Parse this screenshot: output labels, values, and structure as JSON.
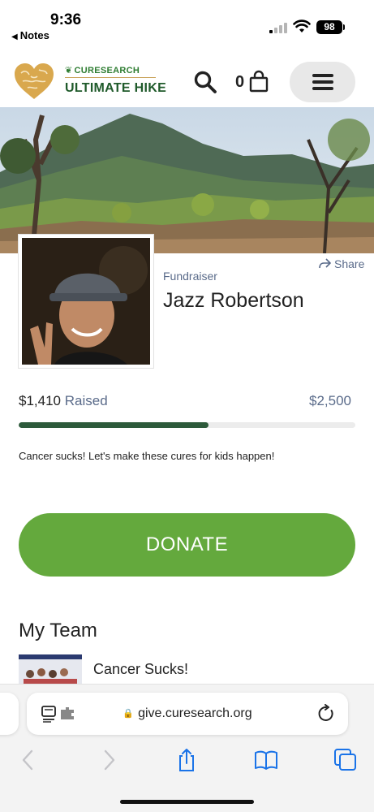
{
  "status": {
    "time": "9:36",
    "back_label": "Notes",
    "battery": "98"
  },
  "header": {
    "brand_small": "CURESEARCH",
    "brand_big": "ULTIMATE HIKE",
    "cart_count": "0"
  },
  "profile": {
    "role": "Fundraiser",
    "name": "Jazz Robertson",
    "share_label": "Share"
  },
  "progress": {
    "raised_amount": "$1,410",
    "raised_word": "Raised",
    "goal": "$2,500",
    "fraction": 0.564
  },
  "tagline": "Cancer sucks! Let's make these cures for kids happen!",
  "donate_label": "DONATE",
  "team": {
    "heading": "My Team",
    "name": "Cancer Sucks!"
  },
  "browser": {
    "url": "give.curesearch.org"
  },
  "colors": {
    "donate": "#64a93d",
    "progress": "#2d5a3b",
    "brand_green": "#1f5a2a",
    "muted_text": "#5a6b8a"
  },
  "icons": [
    "signal-icon",
    "wifi-icon",
    "heart-logo-icon",
    "search-icon",
    "cart-icon",
    "menu-icon",
    "share-icon",
    "reader-icon",
    "lock-icon",
    "reload-icon",
    "back-arrow-icon",
    "forward-arrow-icon",
    "share-sheet-icon",
    "bookmarks-icon",
    "tabs-icon"
  ]
}
